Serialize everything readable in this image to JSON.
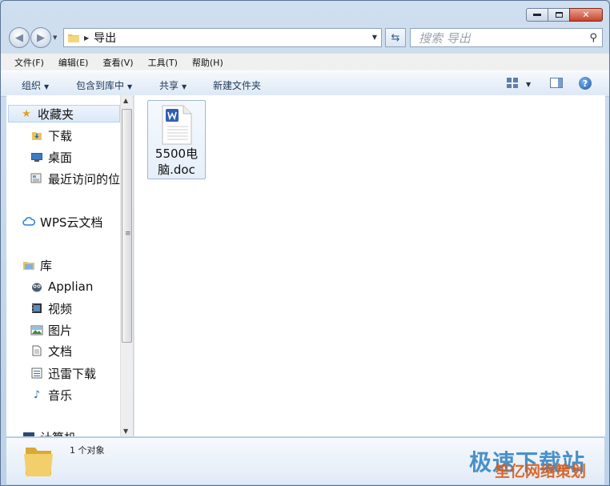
{
  "window": {
    "controls": [
      "minimize",
      "maximize",
      "close"
    ]
  },
  "navigation": {
    "address_path": "导出",
    "search_placeholder": "搜索 导出"
  },
  "menubar": {
    "items": [
      "文件(F)",
      "编辑(E)",
      "查看(V)",
      "工具(T)",
      "帮助(H)"
    ]
  },
  "commandbar": {
    "organize": "组织",
    "include_in_library": "包含到库中",
    "share": "共享",
    "new_folder": "新建文件夹"
  },
  "sidebar": {
    "favorites": {
      "label": "收藏夹",
      "icon": "star-icon"
    },
    "favorite_items": [
      {
        "label": "下载",
        "icon": "download-folder-icon"
      },
      {
        "label": "桌面",
        "icon": "desktop-icon"
      },
      {
        "label": "最近访问的位",
        "icon": "recent-places-icon"
      }
    ],
    "wps_cloud": {
      "label": "WPS云文档",
      "icon": "cloud-icon"
    },
    "libraries": {
      "label": "库",
      "icon": "library-icon"
    },
    "library_items": [
      {
        "label": "Applian",
        "icon": "owl-icon"
      },
      {
        "label": "视频",
        "icon": "video-icon"
      },
      {
        "label": "图片",
        "icon": "picture-icon"
      },
      {
        "label": "文档",
        "icon": "document-icon"
      },
      {
        "label": "迅雷下载",
        "icon": "thunder-download-icon"
      },
      {
        "label": "音乐",
        "icon": "music-icon"
      }
    ],
    "computer": {
      "label": "计算机",
      "icon": "computer-icon"
    }
  },
  "files": [
    {
      "name_line1": "5500电",
      "name_line2": "脑.doc",
      "icon": "wps-word-doc-icon"
    }
  ],
  "status": {
    "count": "1 个对象"
  },
  "watermark": {
    "line1": "极速下载站",
    "line2": "笙亿网络策划"
  },
  "colors": {
    "chrome": "#bdd2e8",
    "accent": "#1e395b",
    "selection": "#dbe8f8",
    "close": "#c7432c"
  }
}
